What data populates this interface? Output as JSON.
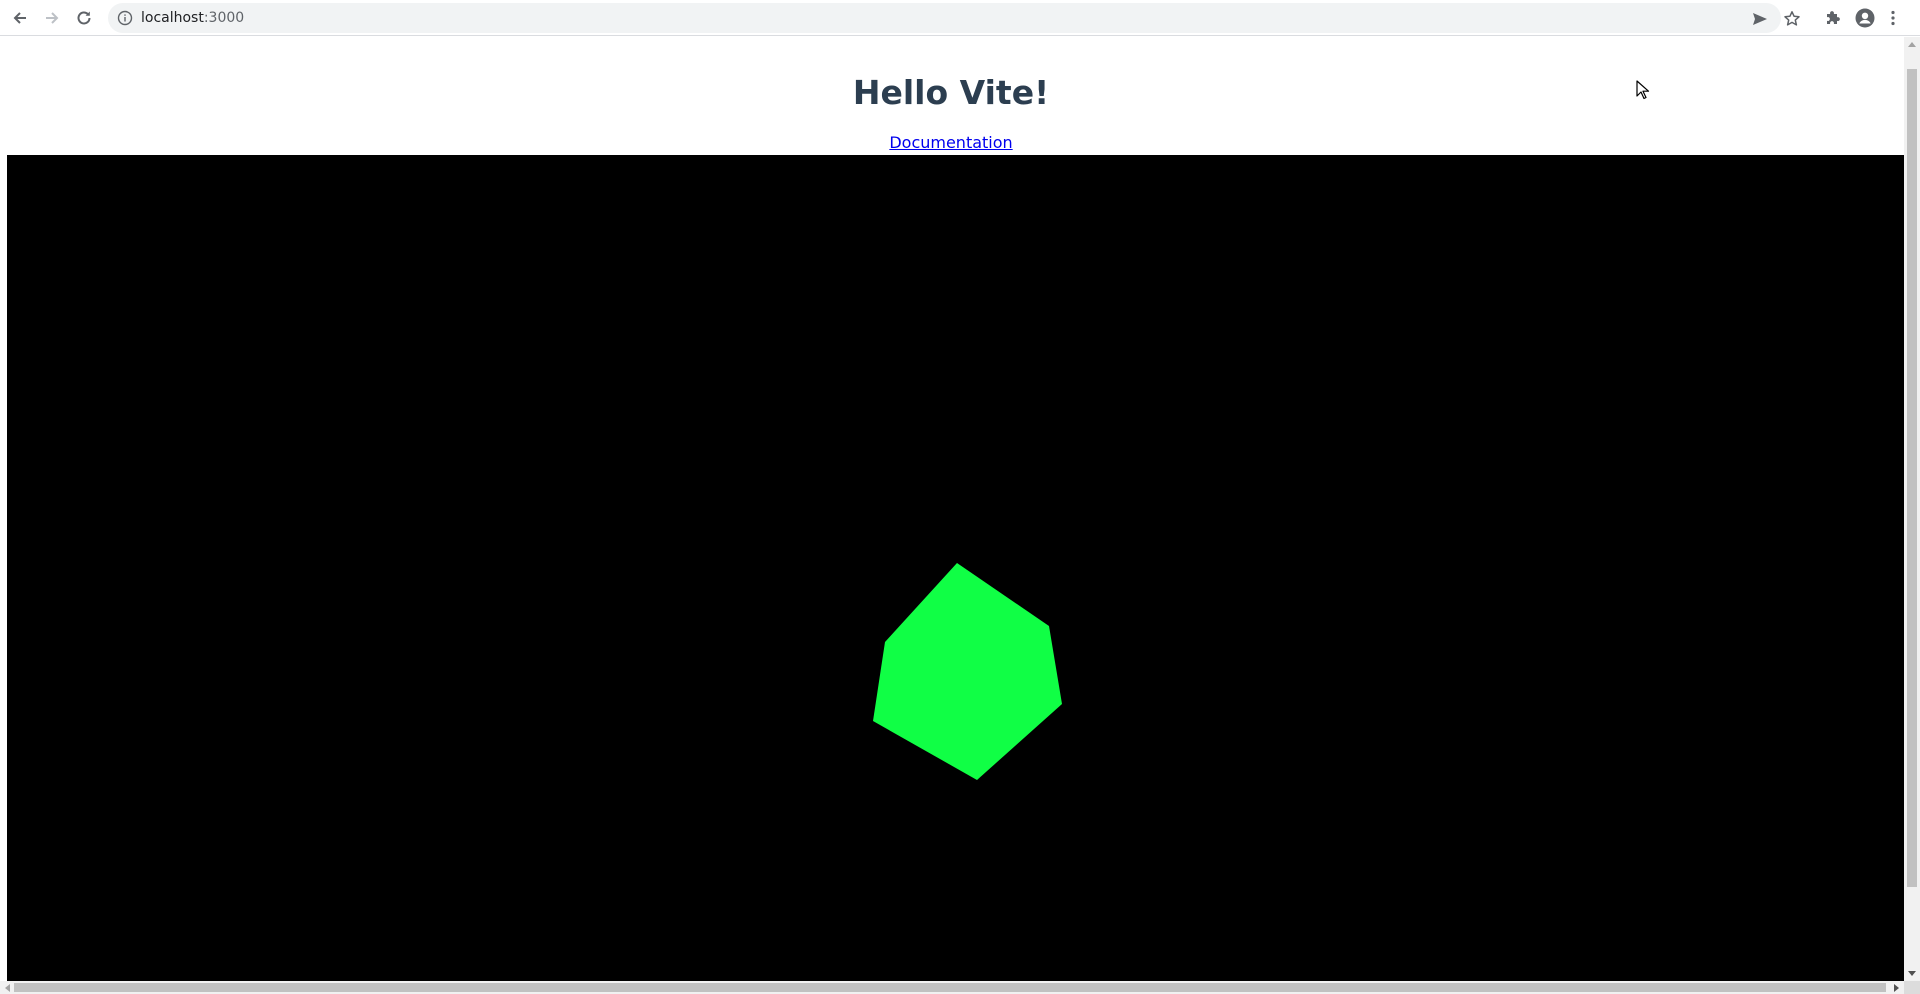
{
  "browser": {
    "url_host": "localhost",
    "url_port": ":3000",
    "icons": {
      "back": "arrow-left-icon",
      "forward": "arrow-right-icon",
      "reload": "reload-icon",
      "info": "info-icon",
      "send": "send-icon",
      "bookmark": "star-icon",
      "extensions": "puzzle-icon",
      "profile": "profile-icon",
      "menu": "kebab-menu-icon"
    }
  },
  "page": {
    "title": "Hello Vite!",
    "link_label": "Documentation",
    "title_color": "#2c3e50",
    "link_color": "#0000ee"
  },
  "scene": {
    "background_color": "#000000",
    "object_color": "#10ff45",
    "object_shape": "rotated cube"
  }
}
